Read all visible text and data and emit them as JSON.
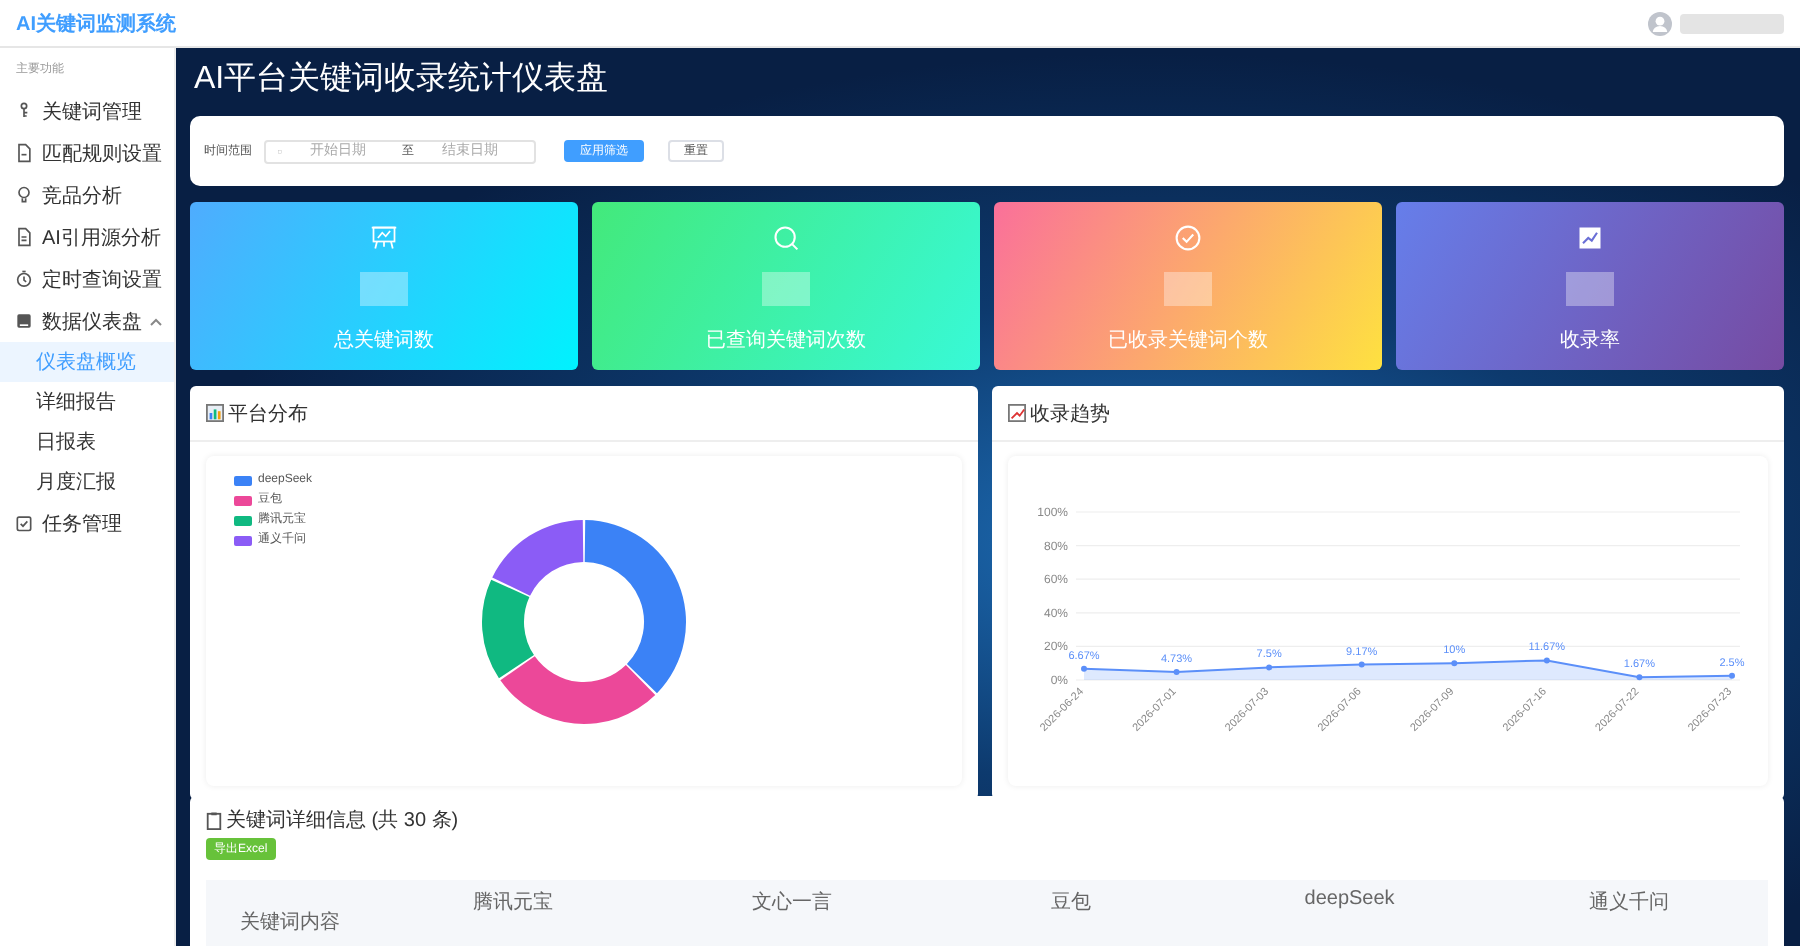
{
  "header": {
    "title": "AI关键词监测系统"
  },
  "sidebar": {
    "section_label": "主要功能",
    "items": [
      {
        "label": "关键词管理",
        "selected": false
      },
      {
        "label": "匹配规则设置",
        "selected": false
      },
      {
        "label": "竞品分析",
        "selected": false
      },
      {
        "label": "AI引用源分析",
        "selected": false
      },
      {
        "label": "定时查询设置",
        "selected": false
      },
      {
        "label": "数据仪表盘",
        "selected": false,
        "expanded": true,
        "children": [
          {
            "label": "仪表盘概览",
            "selected": true
          },
          {
            "label": "详细报告",
            "selected": false
          },
          {
            "label": "日报表",
            "selected": false
          },
          {
            "label": "月度汇报",
            "selected": false
          }
        ]
      },
      {
        "label": "任务管理",
        "selected": false
      }
    ]
  },
  "page_title": "AI平台关键词收录统计仪表盘",
  "filter": {
    "label": "时间范围",
    "start": {
      "placeholder": "开始日期"
    },
    "separator": "至",
    "end": {
      "placeholder": "结束日期"
    },
    "apply_button": "应用筛选",
    "reset_button": "重置"
  },
  "stat_cards": [
    {
      "label": "总关键词数"
    },
    {
      "label": "已查询关键词次数"
    },
    {
      "label": "已收录关键词个数"
    },
    {
      "label": "收录率"
    }
  ],
  "platform_panel": {
    "title": "平台分布",
    "legend": [
      {
        "label": "deepSeek",
        "color": "#3b82f6"
      },
      {
        "label": "豆包",
        "color": "#ec4899"
      },
      {
        "label": "腾讯元宝",
        "color": "#10b981"
      },
      {
        "label": "通义千问",
        "color": "#8b5cf6"
      }
    ]
  },
  "trend_panel": {
    "title": "收录趋势",
    "chart_data": {
      "type": "area",
      "categories": [
        "2026-06-24",
        "2026-07-01",
        "2026-07-03",
        "2026-07-06",
        "2026-07-09",
        "2026-07-16",
        "2026-07-22",
        "2026-07-23"
      ],
      "grid": true,
      "series": [
        {
          "color": "#5b8ff9",
          "values": [
            6.67,
            4.73,
            7.5,
            9.17,
            10,
            11.67,
            1.67,
            2.5
          ]
        }
      ],
      "ylim": [
        0,
        100
      ],
      "yticks": [
        {
          "value": 0,
          "label": "0%"
        },
        {
          "value": 20,
          "label": "20%"
        },
        {
          "value": 40,
          "label": "40%"
        },
        {
          "value": 60,
          "label": "60%"
        },
        {
          "value": 80,
          "label": "80%"
        },
        {
          "value": 100,
          "label": "100%"
        }
      ],
      "value_labels": [
        "6.67%",
        "4.73%",
        "7.5%",
        "9.17%",
        "10%",
        "11.67%",
        "1.67%",
        "2.5%"
      ]
    }
  },
  "table_panel": {
    "title": "关键词详细信息 (共 30 条)",
    "export_button": "导出Excel",
    "columns": [
      "关键词内容",
      "腾讯元宝",
      "文心一言",
      "豆包",
      "deepSeek",
      "通义千问"
    ]
  }
}
